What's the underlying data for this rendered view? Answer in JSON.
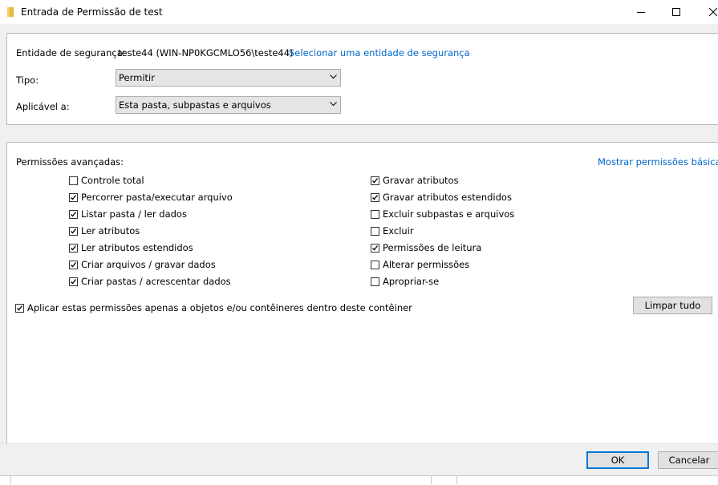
{
  "window": {
    "title": "Entrada de Permissão de test",
    "icon": "folder-icon",
    "controls": [
      "minimize-icon",
      "maximize-icon",
      "close-icon"
    ]
  },
  "principal": {
    "label": "Entidade de segurança:",
    "value": "teste44 (WIN-NP0KGCMLO56\\teste44)",
    "select_link": "Selecionar uma entidade de segurança"
  },
  "type": {
    "label": "Tipo:",
    "value": "Permitir"
  },
  "applies_to": {
    "label": "Aplicável a:",
    "value": "Esta pasta, subpastas e arquivos"
  },
  "advanced": {
    "label": "Permissões avançadas:",
    "basic_link": "Mostrar permissões básicas",
    "left": [
      {
        "label": "Controle total",
        "checked": false
      },
      {
        "label": "Percorrer pasta/executar arquivo",
        "checked": true
      },
      {
        "label": "Listar pasta / ler dados",
        "checked": true
      },
      {
        "label": "Ler atributos",
        "checked": true
      },
      {
        "label": "Ler atributos estendidos",
        "checked": true
      },
      {
        "label": "Criar arquivos / gravar dados",
        "checked": true
      },
      {
        "label": "Criar pastas / acrescentar dados",
        "checked": true
      }
    ],
    "right": [
      {
        "label": "Gravar atributos",
        "checked": true
      },
      {
        "label": "Gravar atributos estendidos",
        "checked": true
      },
      {
        "label": "Excluir subpastas e arquivos",
        "checked": false
      },
      {
        "label": "Excluir",
        "checked": false
      },
      {
        "label": "Permissões de leitura",
        "checked": true
      },
      {
        "label": "Alterar permissões",
        "checked": false
      },
      {
        "label": "Apropriar-se",
        "checked": false
      }
    ]
  },
  "apply_only": {
    "label": "Aplicar estas permissões apenas a objetos e/ou contêineres dentro deste contêiner",
    "checked": true
  },
  "clear_all_label": "Limpar tudo",
  "ok_label": "OK",
  "cancel_label": "Cancelar"
}
